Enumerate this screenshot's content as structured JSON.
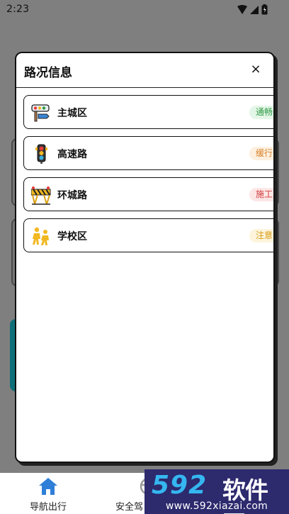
{
  "status_bar": {
    "time": "2:23"
  },
  "dialog": {
    "title": "路况信息",
    "close_label": "×",
    "items": [
      {
        "name": "主城区",
        "status": "通畅",
        "status_color": "#2f9a45",
        "badge_bg": "#e4f6e7",
        "icon": "road-sign-icon"
      },
      {
        "name": "高速路",
        "status": "缓行",
        "status_color": "#d9822b",
        "badge_bg": "#fdf0e0",
        "icon": "traffic-light-icon"
      },
      {
        "name": "环城路",
        "status": "施工",
        "status_color": "#d23b3b",
        "badge_bg": "#fde6e6",
        "icon": "construction-barrier-icon"
      },
      {
        "name": "学校区",
        "status": "注意",
        "status_color": "#d79c12",
        "badge_bg": "#fdf4dc",
        "icon": "school-children-icon"
      }
    ]
  },
  "bottom_nav": {
    "items": [
      {
        "label": "导航出行",
        "icon": "home-icon"
      },
      {
        "label": "安全驾",
        "icon": "steering-wheel-icon"
      }
    ]
  },
  "watermark": {
    "logo": "592",
    "text": "软件园",
    "url": "www.592xiazai.com"
  }
}
